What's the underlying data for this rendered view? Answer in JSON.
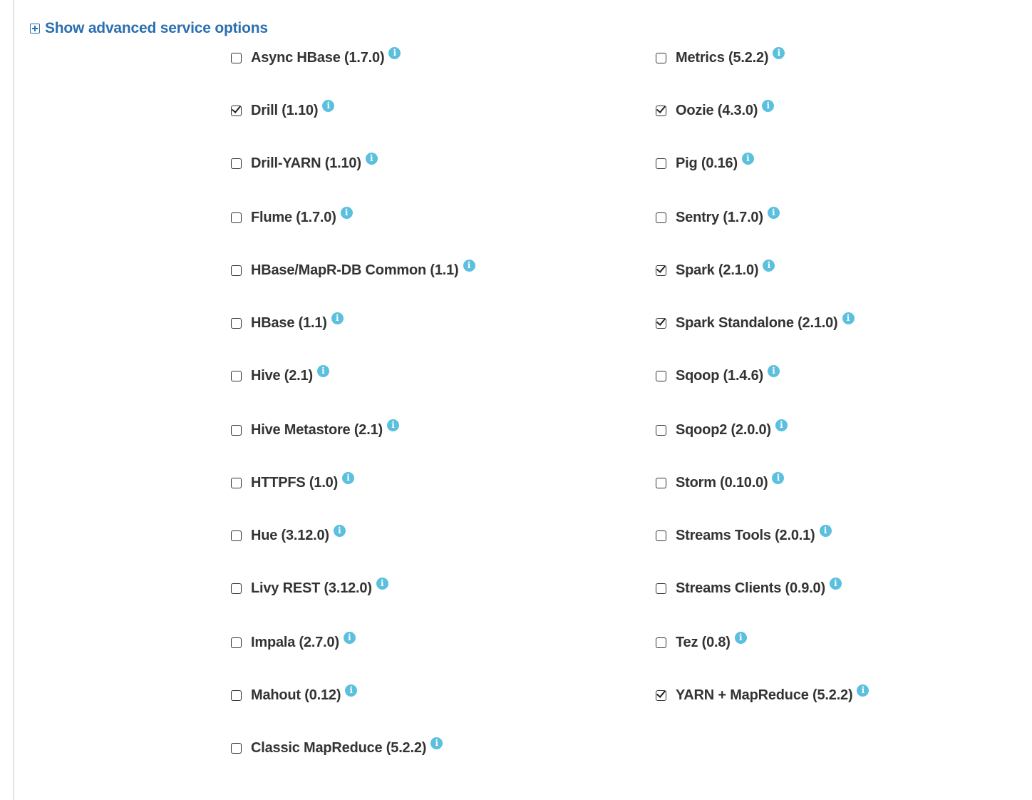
{
  "advanced": {
    "label": "Show advanced service options",
    "icon": "plus-square-icon"
  },
  "colors": {
    "link": "#2a6fb0",
    "info_icon": "#5bc0de",
    "text": "#333333"
  },
  "services_left": [
    {
      "label": "Async HBase (1.7.0)",
      "checked": false
    },
    {
      "label": "Drill (1.10)",
      "checked": true
    },
    {
      "label": "Drill-YARN (1.10)",
      "checked": false
    },
    {
      "label": "Flume (1.7.0)",
      "checked": false
    },
    {
      "label": "HBase/MapR-DB Common (1.1)",
      "checked": false
    },
    {
      "label": "HBase (1.1)",
      "checked": false
    },
    {
      "label": "Hive (2.1)",
      "checked": false
    },
    {
      "label": "Hive Metastore (2.1)",
      "checked": false
    },
    {
      "label": "HTTPFS (1.0)",
      "checked": false
    },
    {
      "label": "Hue (3.12.0)",
      "checked": false
    },
    {
      "label": "Livy REST (3.12.0)",
      "checked": false
    },
    {
      "label": "Impala (2.7.0)",
      "checked": false
    },
    {
      "label": "Mahout (0.12)",
      "checked": false
    },
    {
      "label": "Classic MapReduce (5.2.2)",
      "checked": false
    }
  ],
  "services_right": [
    {
      "label": "Metrics (5.2.2)",
      "checked": false
    },
    {
      "label": "Oozie (4.3.0)",
      "checked": true
    },
    {
      "label": "Pig (0.16)",
      "checked": false
    },
    {
      "label": "Sentry (1.7.0)",
      "checked": false
    },
    {
      "label": "Spark (2.1.0)",
      "checked": true
    },
    {
      "label": "Spark Standalone (2.1.0)",
      "checked": true
    },
    {
      "label": "Sqoop (1.4.6)",
      "checked": false
    },
    {
      "label": "Sqoop2 (2.0.0)",
      "checked": false
    },
    {
      "label": "Storm (0.10.0)",
      "checked": false
    },
    {
      "label": "Streams Tools (2.0.1)",
      "checked": false
    },
    {
      "label": "Streams Clients (0.9.0)",
      "checked": false
    },
    {
      "label": "Tez (0.8)",
      "checked": false
    },
    {
      "label": "YARN + MapReduce (5.2.2)",
      "checked": true
    }
  ],
  "info_icon_glyph": "i"
}
